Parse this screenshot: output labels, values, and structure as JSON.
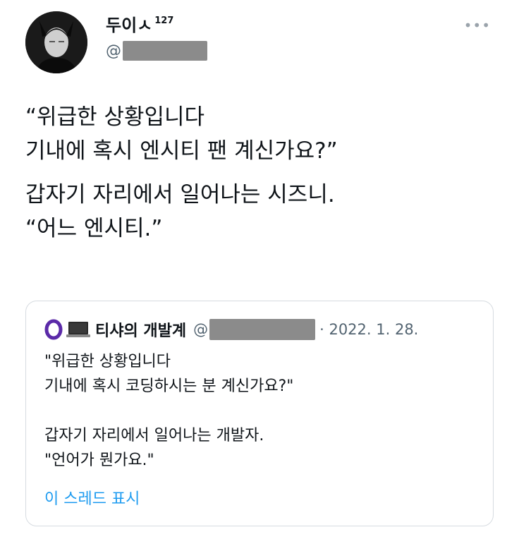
{
  "author": {
    "display_name": "두이ㅅ",
    "display_name_sup": "127",
    "handle_prefix": "@"
  },
  "more_icon": "more-dots-icon",
  "tweet": {
    "paragraph1": [
      "“위급한 상황입니다",
      "기내에 혹시 엔시티 팬 계신가요?”"
    ],
    "paragraph2": [
      "갑자기 자리에서 일어나는 시즈니.",
      "“어느 엔시티.”"
    ]
  },
  "quote": {
    "author_name": "티샤의 개발계",
    "handle_prefix": "@",
    "date": "· 2022. 1. 28.",
    "lines": [
      "\"위급한 상황입니다",
      "기내에 혹시 코딩하시는 분 계신가요?\"",
      "갑자기 자리에서 일어나는 개발자.",
      "\"언어가 뭔가요.\""
    ],
    "show_thread": "이 스레드 표시"
  },
  "colors": {
    "link": "#1d9bf0",
    "secondary_text": "#536471",
    "redaction": "#8b8b8b"
  }
}
